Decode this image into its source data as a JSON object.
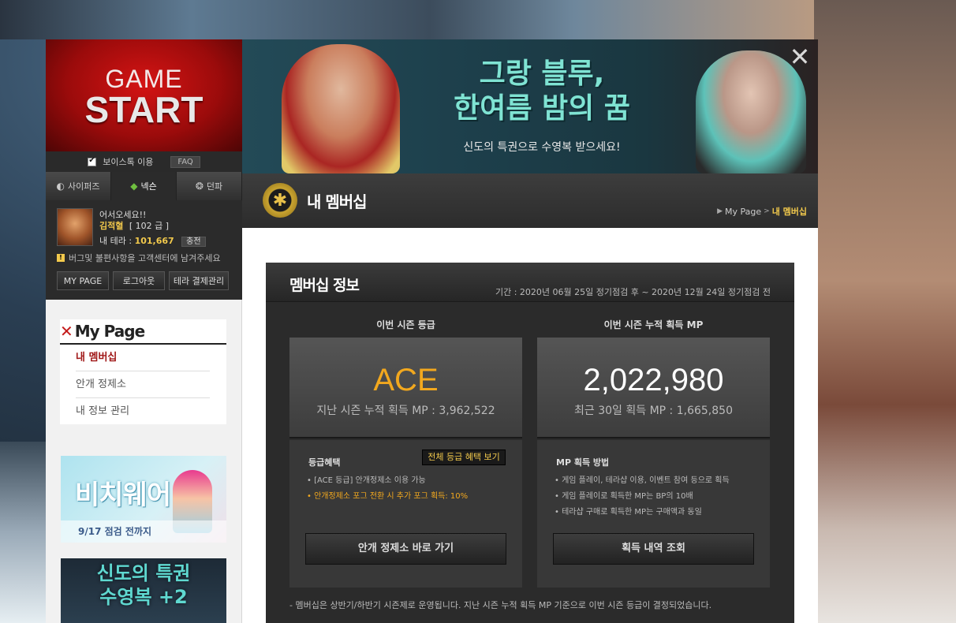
{
  "game_start": {
    "line1": "GAME",
    "line2": "START"
  },
  "voice_talk": {
    "label": "보이스톡 이용",
    "faq": "FAQ"
  },
  "login_tabs": [
    {
      "label": "사이퍼즈",
      "icon": "cyphers-icon"
    },
    {
      "label": "넥슨",
      "icon": "nexon-icon"
    },
    {
      "label": "던파",
      "icon": "dnf-icon"
    }
  ],
  "user": {
    "welcome": "어서오세요!!",
    "name": "김적혈",
    "level": "[ 102 급 ]",
    "tera_label": "내 테라 :",
    "tera_value": "101,667",
    "charge": "충전",
    "notice": "버그및 불편사항을 고객센터에 남겨주세요"
  },
  "account_buttons": [
    "MY PAGE",
    "로그아웃",
    "테라 결제관리"
  ],
  "mypage": {
    "title": "My Page",
    "menu": [
      "내 멤버십",
      "안개 정제소",
      "내 정보 관리"
    ]
  },
  "banner1": {
    "title": "비치웨어",
    "sub": "9/17 점검 전까지"
  },
  "banner2": {
    "title": "신도의 특권\n수영복 +2"
  },
  "top_banner": {
    "title": "그랑 블루,\n한여름 밤의 꿈",
    "subtitle": "신도의 특권으로 수영복 받으세요!",
    "close": "✕"
  },
  "page_header": {
    "title": "내 멤버십",
    "breadcrumb": [
      "My Page",
      "내 멤버십"
    ]
  },
  "membership": {
    "title": "멤버십 정보",
    "period": "기간 : 2020년 06월 25일 정기점검 후 ~ 2020년 12월 24일 정기점검 전",
    "left": {
      "label": "이번 시즌 등급",
      "value": "ACE",
      "sub": "지난 시즌 누적 획득 MP : 3,962,522",
      "info_title": "등급혜택",
      "info_button": "전체 등급 혜택 보기",
      "lines": [
        "• [ACE 등급] 안개정제소 이용 가능",
        "• 안개정제소 포그 전환 시 추가 포그 획득: 10%"
      ],
      "action": "안개 정제소 바로 가기"
    },
    "right": {
      "label": "이번 시즌  누적 획득 MP",
      "value": "2,022,980",
      "sub": "최근 30일 획득 MP : 1,665,850",
      "info_title": "MP 획득 방법",
      "lines": [
        "• 게임 플레이, 테라샵 이용, 이벤트 참여 등으로 획득",
        "• 게임 플레이로 획득한 MP는 BP의 10배",
        "• 테라샵 구매로 획득한 MP는 구매액과 동일"
      ],
      "action": "획득 내역 조회"
    },
    "footnote": "- 멤버십은 상반기/하반기 시즌제로 운영됩니다. 지난 시즌 누적 획득 MP 기준으로 이번 시즌 등급이 결정되었습니다."
  },
  "colors": {
    "accent_gold": "#f2c94c",
    "ace_gold": "#f2a81e",
    "active_red": "#a01818",
    "dark_panel": "#2b2b2b"
  }
}
